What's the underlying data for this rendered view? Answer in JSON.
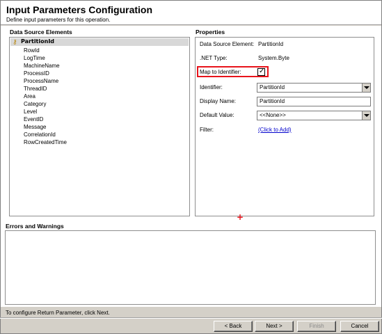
{
  "header": {
    "title": "Input Parameters Configuration",
    "subtitle": "Define input parameters for this operation."
  },
  "data_source": {
    "title": "Data Source Elements",
    "selected": "PartitionId",
    "items": [
      "RowId",
      "LogTime",
      "MachineName",
      "ProcessID",
      "ProcessName",
      "ThreadID",
      "Area",
      "Category",
      "Level",
      "EventID",
      "Message",
      "CorrelationId",
      "RowCreatedTime"
    ]
  },
  "properties": {
    "title": "Properties",
    "data_source_element_label": "Data Source Element:",
    "data_source_element_value": "PartitionId",
    "net_type_label": ".NET Type:",
    "net_type_value": "System.Byte",
    "map_to_identifier_label": "Map to Identifier:",
    "map_to_identifier_checked": true,
    "identifier_label": "Identifier:",
    "identifier_value": "PartitionId",
    "display_name_label": "Display Name:",
    "display_name_value": "PartitionId",
    "default_value_label": "Default Value:",
    "default_value_value": "<<None>>",
    "filter_label": "Filter:",
    "filter_link": "(Click to Add)"
  },
  "errors": {
    "title": "Errors and Warnings"
  },
  "footer": {
    "hint": "To configure Return Parameter, click Next.",
    "back_label": "< Back",
    "next_label": "Next >",
    "finish_label": "Finish",
    "cancel_label": "Cancel"
  },
  "colors": {
    "highlight": "#e8131b",
    "link": "#0000cc"
  }
}
